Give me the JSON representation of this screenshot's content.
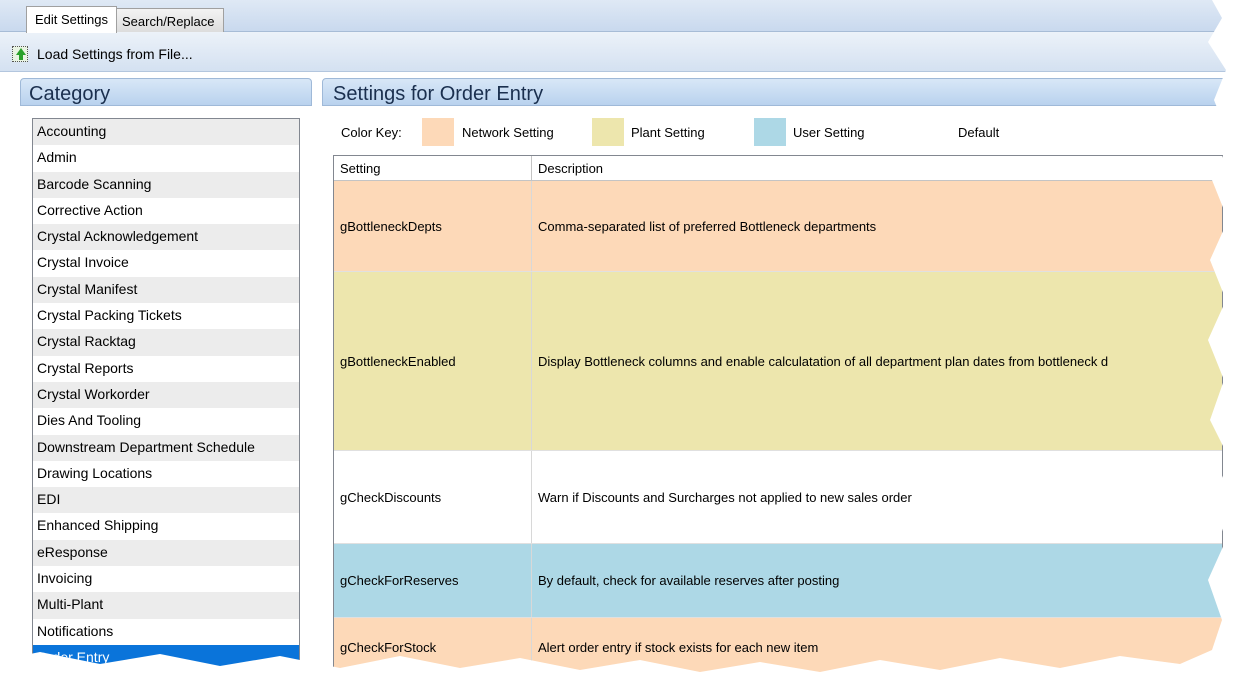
{
  "tabs": [
    {
      "label": "Edit Settings",
      "active": true
    },
    {
      "label": "Search/Replace",
      "active": false
    }
  ],
  "toolbar": {
    "load_label": "Load Settings from File...",
    "load_icon": "load-file-icon"
  },
  "category": {
    "header": "Category",
    "items": [
      "Accounting",
      "Admin",
      "Barcode Scanning",
      "Corrective Action",
      "Crystal Acknowledgement",
      "Crystal Invoice",
      "Crystal Manifest",
      "Crystal Packing Tickets",
      "Crystal Racktag",
      "Crystal Reports",
      "Crystal Workorder",
      "Dies And Tooling",
      "Downstream Department Schedule",
      "Drawing Locations",
      "EDI",
      "Enhanced Shipping",
      "eResponse",
      "Invoicing",
      "Multi-Plant",
      "Notifications",
      "Order Entry"
    ],
    "selected": "Order Entry"
  },
  "settings": {
    "header": "Settings for Order Entry",
    "color_key": {
      "label": "Color Key:",
      "network": {
        "label": "Network Setting",
        "color": "#fdd9b8"
      },
      "plant": {
        "label": "Plant Setting",
        "color": "#ede6ad"
      },
      "user": {
        "label": "User Setting",
        "color": "#add8e6"
      },
      "default": {
        "label": "Default",
        "color": "#ffffff"
      }
    },
    "columns": {
      "setting": "Setting",
      "description": "Description"
    },
    "rows": [
      {
        "setting": "gBottleneckDepts",
        "description": "Comma-separated list of preferred Bottleneck departments",
        "type": "network"
      },
      {
        "setting": "gBottleneckEnabled",
        "description": "Display Bottleneck columns and enable calculatation of all department plan dates from bottleneck d",
        "type": "plant"
      },
      {
        "setting": "gCheckDiscounts",
        "description": "Warn if Discounts and Surcharges not applied to new sales order",
        "type": "default"
      },
      {
        "setting": "gCheckForReserves",
        "description": "By default, check for available reserves after posting",
        "type": "user"
      },
      {
        "setting": "gCheckForStock",
        "description": "Alert order entry if stock exists for each new item",
        "type": "network"
      }
    ]
  }
}
